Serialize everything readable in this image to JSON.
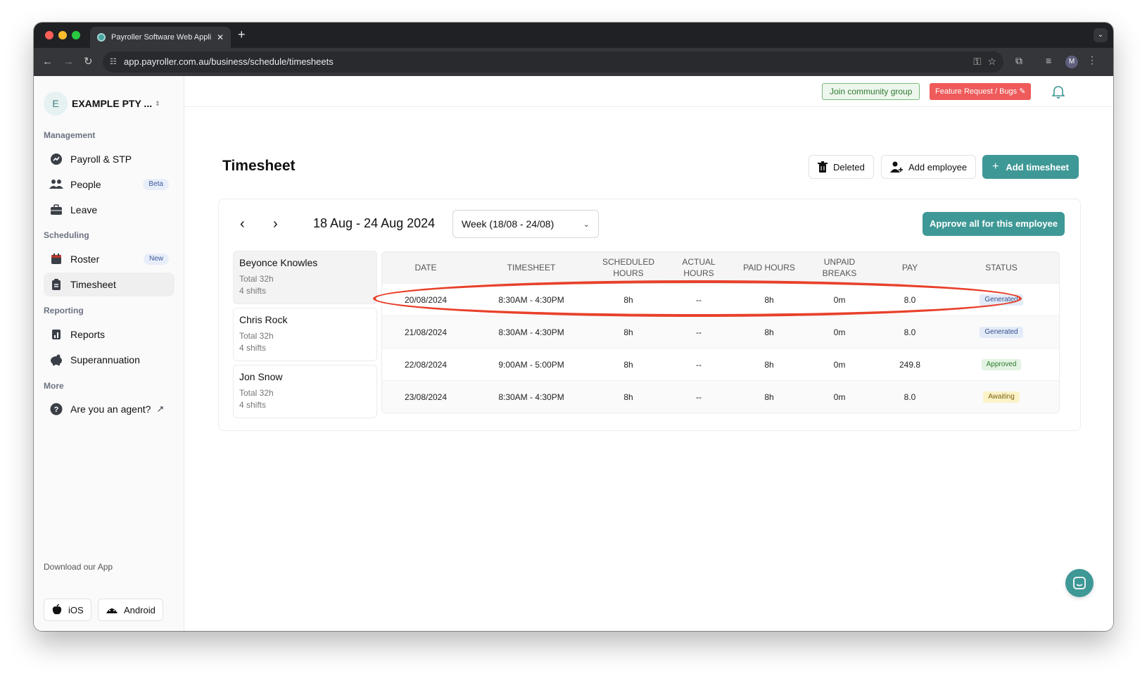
{
  "browser": {
    "tab_title": "Payroller Software Web Appli",
    "tab_close": "✕",
    "new_tab": "+",
    "url": "app.payroller.com.au/business/schedule/timesheets",
    "avatar_initial": "M"
  },
  "sidebar": {
    "business_initial": "E",
    "business_name": "EXAMPLE PTY ...",
    "sections": {
      "management": "Management",
      "scheduling": "Scheduling",
      "reporting": "Reporting",
      "more": "More"
    },
    "items": [
      {
        "label": "Payroll & STP",
        "icon": "payroll-icon"
      },
      {
        "label": "People",
        "icon": "people-icon",
        "badge": "Beta"
      },
      {
        "label": "Leave",
        "icon": "briefcase-icon"
      },
      {
        "label": "Roster",
        "icon": "calendar-icon",
        "badge": "New"
      },
      {
        "label": "Timesheet",
        "icon": "timesheet-icon",
        "active": true
      },
      {
        "label": "Reports",
        "icon": "reports-icon"
      },
      {
        "label": "Superannuation",
        "icon": "piggy-bank-icon"
      },
      {
        "label": "Are you an agent?",
        "icon": "help-icon"
      }
    ],
    "download_label": "Download our App",
    "ios_label": "iOS",
    "android_label": "Android"
  },
  "topbar": {
    "community_label": "Join community group",
    "feature_label": "Feature Request / Bugs ✎"
  },
  "page": {
    "title": "Timesheet",
    "deleted_label": "Deleted",
    "add_employee_label": "Add employee",
    "add_timesheet_label": "Add timesheet",
    "date_range": "18 Aug - 24 Aug 2024",
    "week_selected": "Week (18/08 - 24/08)",
    "approve_all_label": "Approve all for this employee"
  },
  "employees": [
    {
      "name": "Beyonce Knowles",
      "total": "Total 32h",
      "shifts": "4 shifts",
      "selected": true
    },
    {
      "name": "Chris Rock",
      "total": "Total 32h",
      "shifts": "4 shifts"
    },
    {
      "name": "Jon Snow",
      "total": "Total 32h",
      "shifts": "4 shifts"
    }
  ],
  "table": {
    "headers": {
      "date": "DATE",
      "timesheet": "TIMESHEET",
      "scheduled_1": "SCHEDULED",
      "scheduled_2": "HOURS",
      "actual_1": "ACTUAL",
      "actual_2": "HOURS",
      "paid": "PAID HOURS",
      "unpaid_1": "UNPAID",
      "unpaid_2": "BREAKS",
      "pay": "PAY",
      "status": "STATUS"
    },
    "rows": [
      {
        "date": "20/08/2024",
        "timesheet": "8:30AM - 4:30PM",
        "scheduled": "8h",
        "actual": "--",
        "paid": "8h",
        "unpaid": "0m",
        "pay": "8.0",
        "status": "Generated"
      },
      {
        "date": "21/08/2024",
        "timesheet": "8:30AM - 4:30PM",
        "scheduled": "8h",
        "actual": "--",
        "paid": "8h",
        "unpaid": "0m",
        "pay": "8.0",
        "status": "Generated"
      },
      {
        "date": "22/08/2024",
        "timesheet": "9:00AM - 5:00PM",
        "scheduled": "8h",
        "actual": "--",
        "paid": "8h",
        "unpaid": "0m",
        "pay": "249.8",
        "status": "Approved"
      },
      {
        "date": "23/08/2024",
        "timesheet": "8:30AM - 4:30PM",
        "scheduled": "8h",
        "actual": "--",
        "paid": "8h",
        "unpaid": "0m",
        "pay": "8.0",
        "status": "Awaiting"
      }
    ]
  },
  "colors": {
    "accent": "#3e9896",
    "highlight": "#e8412b",
    "feature": "#ef5a5a"
  }
}
